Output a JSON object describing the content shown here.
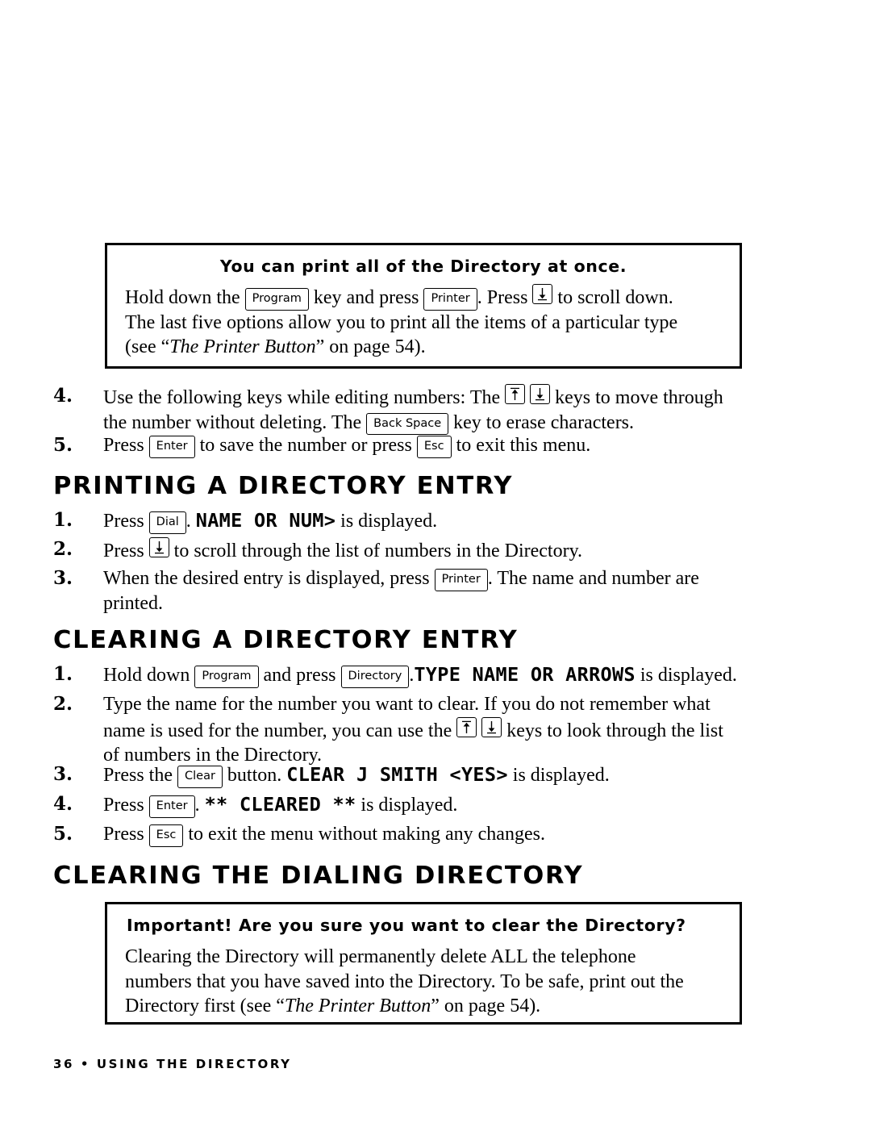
{
  "callout_top": {
    "title": "You can print all of the Directory at once.",
    "line1_pre": "Hold down the",
    "key_program": "Program",
    "line1_mid": "key and press",
    "key_printer": "Printer",
    "line1_mid2": ". Press",
    "key_down_arrow": "down-arrow",
    "line1_post": "to scroll down.",
    "line2": "The last five options allow you to print all the items of a particular type",
    "line3_pre": "(see “",
    "line3_italic": "The Printer Button",
    "line3_post": "” on page 54)."
  },
  "steps_top": [
    {
      "num": "4.",
      "pre": "Use the following keys while editing numbers: The",
      "key_up": "up-arrow",
      "key_down": "down-arrow",
      "mid": "keys to move through",
      "line2_pre": "the number without deleting. The",
      "key_back": "Back Space",
      "line2_post": "key to erase characters."
    },
    {
      "num": "5.",
      "pre": "Press",
      "key_enter": "Enter",
      "mid": "to save the number or press",
      "key_esc": "Esc",
      "post": "to exit this menu."
    }
  ],
  "heading_printing": "PRINTING A DIRECTORY ENTRY",
  "steps_printing": [
    {
      "num": "1.",
      "pre": "Press",
      "key": "Dial",
      "mid": ".",
      "lcd": "NAME OR NUM>",
      "post": "is displayed."
    },
    {
      "num": "2.",
      "pre": "Press",
      "key": "down-arrow",
      "post": "to scroll through the list of numbers in the Directory."
    },
    {
      "num": "3.",
      "pre": "When the desired entry is displayed, press",
      "key": "Printer",
      "post": ". The name and number are",
      "line2": "printed."
    }
  ],
  "heading_clearing_entry": "CLEARING A DIRECTORY ENTRY",
  "steps_clearing_entry": [
    {
      "num": "1.",
      "pre": "Hold down",
      "key1": "Program",
      "mid": "and press",
      "key2": "Directory",
      "mid2": ".",
      "lcd": "TYPE NAME OR ARROWS",
      "post": "is displayed."
    },
    {
      "num": "2.",
      "line1": "Type the name for the number you want to clear. If you do not remember what",
      "line2_pre": "name is used for the number, you can use the",
      "key_up": "up-arrow",
      "key_down": "down-arrow",
      "line2_post": "keys to look through the list",
      "line3": "of numbers in the Directory."
    },
    {
      "num": "3.",
      "pre": "Press the",
      "key": "Clear",
      "mid": "button.",
      "lcd": "CLEAR J SMITH  <YES>",
      "post": "is displayed."
    },
    {
      "num": "4.",
      "pre": "Press",
      "key": "Enter",
      "mid": ".",
      "lcd": "** CLEARED **",
      "post": "is displayed."
    },
    {
      "num": "5.",
      "pre": "Press",
      "key": "Esc",
      "post": "to exit the menu without making any changes."
    }
  ],
  "heading_clearing_directory": "CLEARING THE DIALING DIRECTORY",
  "callout_bottom": {
    "title": "Important! Are you sure you want to clear the Directory?",
    "line1": "Clearing the Directory will permanently delete ALL the telephone",
    "line2": "numbers that you have saved into the Directory. To be safe, print out the",
    "line3_pre": "Directory first (see “",
    "line3_italic": "The Printer Button",
    "line3_post": "” on page 54)."
  },
  "footer": "36 • USING THE DIRECTORY"
}
